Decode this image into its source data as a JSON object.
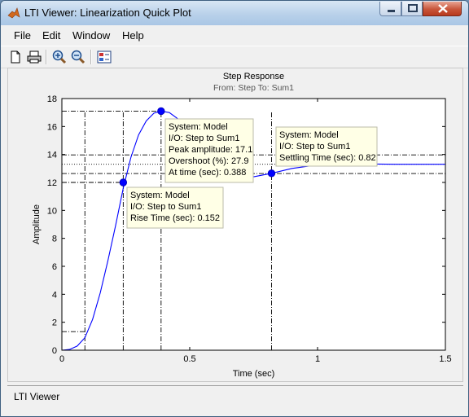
{
  "window": {
    "title": "LTI Viewer: Linearization Quick Plot"
  },
  "icons": {
    "app": "matlab-logo-icon",
    "new": "new-document-icon",
    "print": "print-icon",
    "zoom_in": "zoom-in-icon",
    "zoom_out": "zoom-out-icon",
    "plot_config": "plot-configurations-icon"
  },
  "menu": [
    {
      "label": "File"
    },
    {
      "label": "Edit"
    },
    {
      "label": "Window"
    },
    {
      "label": "Help"
    }
  ],
  "status": {
    "text": "LTI Viewer"
  },
  "chart_data": {
    "type": "line",
    "title": "Step Response",
    "subtitle": "From: Step  To: Sum1",
    "xlabel": "Time (sec)",
    "ylabel": "Amplitude",
    "xlim": [
      0,
      1.5
    ],
    "ylim": [
      0,
      18
    ],
    "xticks": [
      "0",
      "0.5",
      "1",
      "1.5"
    ],
    "yticks": [
      "0",
      "2",
      "4",
      "6",
      "8",
      "10",
      "12",
      "14",
      "16",
      "18"
    ],
    "final_value": 13.3,
    "x": [
      0,
      0.03,
      0.06,
      0.09,
      0.12,
      0.15,
      0.18,
      0.21,
      0.24,
      0.27,
      0.3,
      0.33,
      0.36,
      0.388,
      0.42,
      0.45,
      0.48,
      0.51,
      0.55,
      0.6,
      0.65,
      0.7,
      0.75,
      0.82,
      0.9,
      1.0,
      1.1,
      1.2,
      1.3,
      1.4,
      1.5
    ],
    "y": [
      0,
      0.05,
      0.3,
      0.9,
      2.2,
      4.1,
      6.4,
      8.9,
      11.6,
      13.8,
      15.4,
      16.4,
      16.95,
      17.1,
      17.0,
      16.6,
      16.0,
      15.3,
      14.4,
      13.4,
      12.8,
      12.45,
      12.4,
      12.65,
      13.0,
      13.25,
      13.35,
      13.32,
      13.3,
      13.3,
      13.3
    ],
    "markers": [
      {
        "x": 0.152,
        "y": 12.0
      },
      {
        "x": 0.388,
        "y": 17.1
      },
      {
        "x": 0.82,
        "y": 12.65
      }
    ],
    "guides": {
      "rise_start_x": 0.09,
      "rise_start_y": 1.33,
      "band_upper": 13.97,
      "band_lower": 12.64,
      "final": 13.3,
      "vertical_x": [
        0.09,
        0.24,
        0.388,
        0.82
      ],
      "dotted_y": [
        13.3
      ]
    },
    "series_color": "#0000ff",
    "annotations": [
      {
        "lines": [
          "System: Model",
          "I/O: Step to Sum1",
          "Peak amplitude: 17.1",
          "Overshoot (%): 27.9",
          "At time (sec): 0.388"
        ]
      },
      {
        "lines": [
          "System: Model",
          "I/O: Step to Sum1",
          "Rise Time (sec): 0.152"
        ]
      },
      {
        "lines": [
          "System: Model",
          "I/O: Step to Sum1",
          "Settling Time (sec): 0.82"
        ]
      }
    ]
  }
}
